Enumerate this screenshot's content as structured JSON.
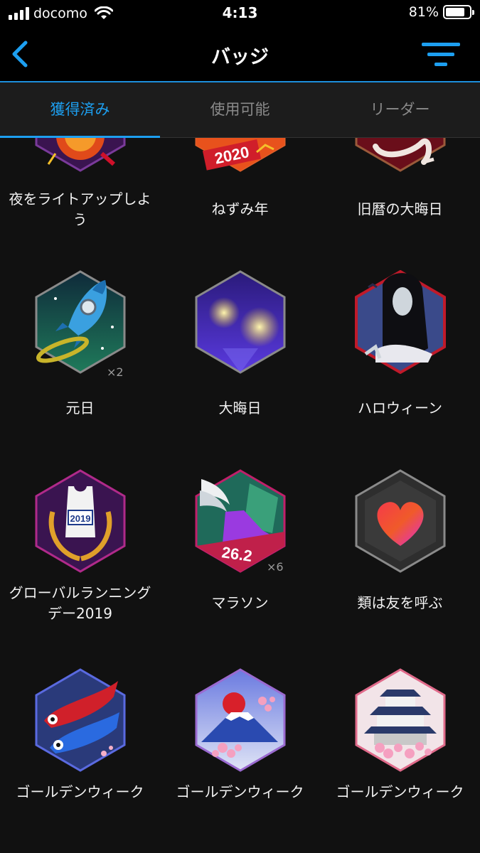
{
  "status_bar": {
    "carrier": "docomo",
    "time": "4:13",
    "battery": "81%",
    "battery_level": 0.81
  },
  "nav": {
    "title": "バッジ",
    "back_icon": "chevron-left-icon",
    "filter_icon": "filter-icon"
  },
  "tabs": [
    {
      "label": "獲得済み",
      "active": true
    },
    {
      "label": "使用可能",
      "active": false
    },
    {
      "label": "リーダー",
      "active": false
    }
  ],
  "badges": [
    {
      "label": "夜をライトアップしよう",
      "count": "",
      "icon": "lantern-badge-icon"
    },
    {
      "label": "ねずみ年",
      "count": "",
      "icon": "year-2020-badge-icon",
      "art_text": "2020"
    },
    {
      "label": "旧暦の大晦日",
      "count": "",
      "icon": "lunar-new-year-badge-icon"
    },
    {
      "label": "元日",
      "count": "×2",
      "icon": "rocket-badge-icon"
    },
    {
      "label": "大晦日",
      "count": "",
      "icon": "fireworks-badge-icon"
    },
    {
      "label": "ハロウィーン",
      "count": "",
      "icon": "ghost-badge-icon"
    },
    {
      "label": "グローバルランニングデー2019",
      "count": "",
      "icon": "running-vest-badge-icon",
      "art_text": "2019"
    },
    {
      "label": "マラソン",
      "count": "×6",
      "icon": "winged-shoe-badge-icon",
      "art_text": "26.2"
    },
    {
      "label": "類は友を呼ぶ",
      "count": "",
      "icon": "heart-badge-icon"
    },
    {
      "label": "ゴールデンウィーク",
      "count": "",
      "icon": "koinobori-badge-icon"
    },
    {
      "label": "ゴールデンウィーク",
      "count": "",
      "icon": "mount-fuji-badge-icon"
    },
    {
      "label": "ゴールデンウィーク",
      "count": "",
      "icon": "castle-badge-icon"
    }
  ],
  "colors": {
    "accent": "#1d9ff0",
    "background": "#111111",
    "tabbar": "#1c1c1c"
  }
}
